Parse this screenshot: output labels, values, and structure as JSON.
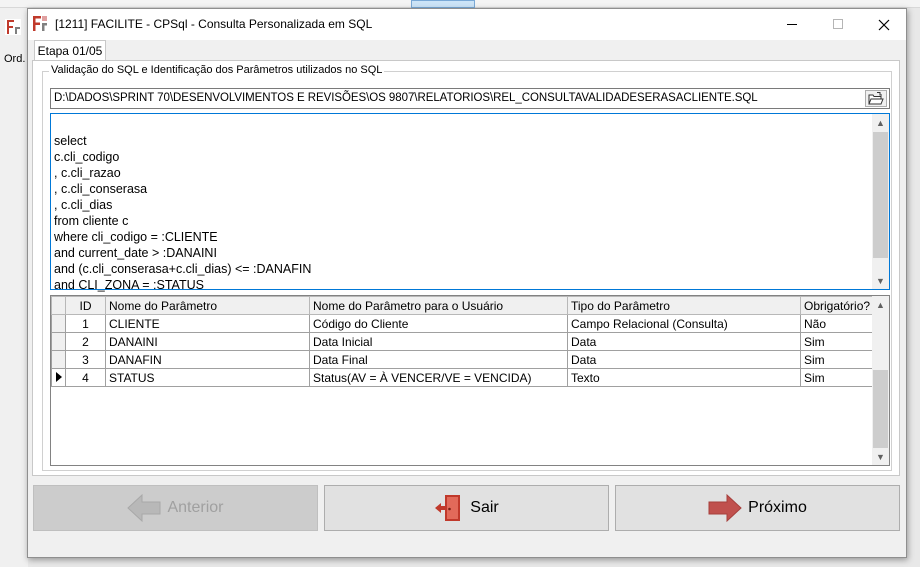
{
  "background": {
    "side_label": "Ord."
  },
  "window": {
    "title": "[1211] FACILITE - CPSql - Consulta Personalizada em SQL"
  },
  "tab": {
    "label": "Etapa 01/05"
  },
  "group": {
    "title": "Validação do SQL e Identificação dos Parâmetros utilizados no SQL"
  },
  "path": {
    "value": "D:\\DADOS\\SPRINT 70\\DESENVOLVIMENTOS E REVISÕES\\OS 9807\\RELATORIOS\\REL_CONSULTAVALIDADESERASACLIENTE.SQL"
  },
  "sql": {
    "lines": [
      "select",
      "c.cli_codigo",
      ", c.cli_razao",
      ", c.cli_conserasa",
      ", c.cli_dias",
      "from cliente c",
      "where cli_codigo = :CLIENTE",
      "and current_date > :DANAINI",
      "and (c.cli_conserasa+c.cli_dias) <= :DANAFIN",
      "and CLI_ZONA = :STATUS"
    ]
  },
  "grid": {
    "columns": [
      "ID",
      "Nome do Parâmetro",
      "Nome do Parâmetro para o Usuário",
      "Tipo do Parâmetro",
      "Obrigatório?"
    ],
    "rows": [
      {
        "id": "1",
        "name": "CLIENTE",
        "user_name": "Código do Cliente",
        "type": "Campo Relacional (Consulta)",
        "required": "Não"
      },
      {
        "id": "2",
        "name": "DANAINI",
        "user_name": "Data Inicial",
        "type": "Data",
        "required": "Sim"
      },
      {
        "id": "3",
        "name": "DANAFIN",
        "user_name": "Data Final",
        "type": "Data",
        "required": "Sim"
      },
      {
        "id": "4",
        "name": "STATUS",
        "user_name": "Status(AV = À VENCER/VE = VENCIDA)",
        "type": "Texto",
        "required": "Sim"
      }
    ]
  },
  "buttons": {
    "prev": "Anterior",
    "exit": "Sair",
    "next": "Próximo"
  },
  "colors": {
    "arrow_disabled": "#b8b8b8",
    "arrow_next": "#c0504d",
    "door": "#c0392b",
    "focus_border": "#0078d7"
  }
}
